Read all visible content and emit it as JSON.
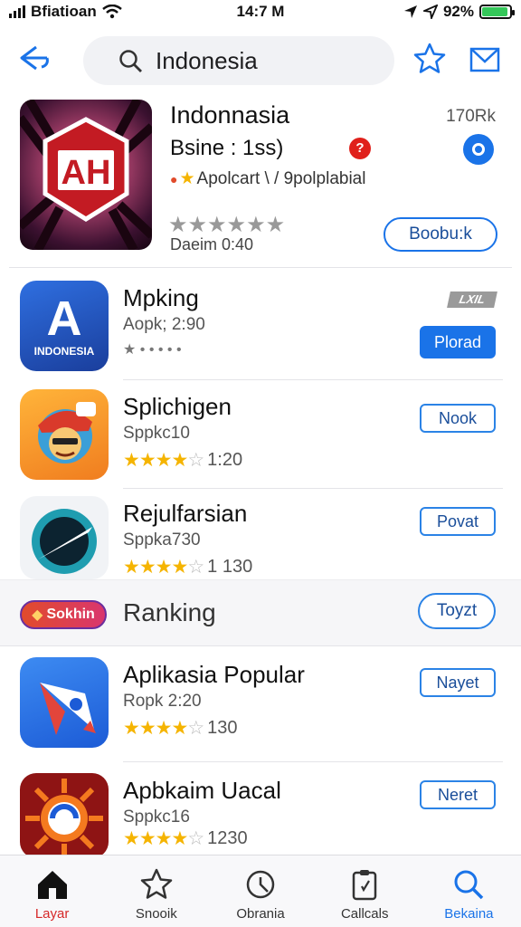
{
  "status_bar": {
    "carrier": "Bfiatioan",
    "time": "14:7 M",
    "battery": "92%",
    "battery_level": 0.92
  },
  "search": {
    "query": "Indonesia"
  },
  "featured": {
    "name": "Indonnasia",
    "subtitle": "Bsine : 1ss)",
    "badge": "?",
    "developer": "Apolcart \\ / 9polplabial",
    "size": "170Rk",
    "date": "Daeim 0:40",
    "button": "Boobu:k",
    "rating": 0,
    "icon_text": "AH"
  },
  "apps": [
    {
      "name": "Mpking",
      "subtitle": "Aopk; 2:90",
      "button": "Plorad",
      "tag": "LXIL",
      "icon_text": "A",
      "icon_caption": "INDONESIA",
      "rating_dots": "★ • • • • •"
    },
    {
      "name": "Splichigen",
      "subtitle": "Sppkc10",
      "button": "Nook",
      "rating_text": "1:20",
      "stars": 4
    },
    {
      "name": "Rejulfarsian",
      "subtitle": "Sppka730",
      "button": "Povat",
      "rating_text": "1 130",
      "stars": 4
    }
  ],
  "section": {
    "pill": "Sokhin",
    "title": "Ranking",
    "button": "Toyzt"
  },
  "apps2": [
    {
      "name": "Aplikasia Popular",
      "subtitle": "Ropk 2:20",
      "button": "Nayet",
      "rating_text": "130",
      "stars": 4
    },
    {
      "name": "Apbkaim Uacal",
      "subtitle": "Sppkc16",
      "button": "Neret",
      "rating_text": "1230",
      "stars": 4
    }
  ],
  "tabs": [
    {
      "label": "Layar",
      "icon": "home-icon"
    },
    {
      "label": "Snooik",
      "icon": "star-icon"
    },
    {
      "label": "Obrania",
      "icon": "clock-icon"
    },
    {
      "label": "Callcals",
      "icon": "clipboard-icon"
    },
    {
      "label": "Bekaina",
      "icon": "search-icon"
    }
  ],
  "colors": {
    "accent": "#1a73e8",
    "star": "#f5b400",
    "active_tab": "#d62828"
  }
}
